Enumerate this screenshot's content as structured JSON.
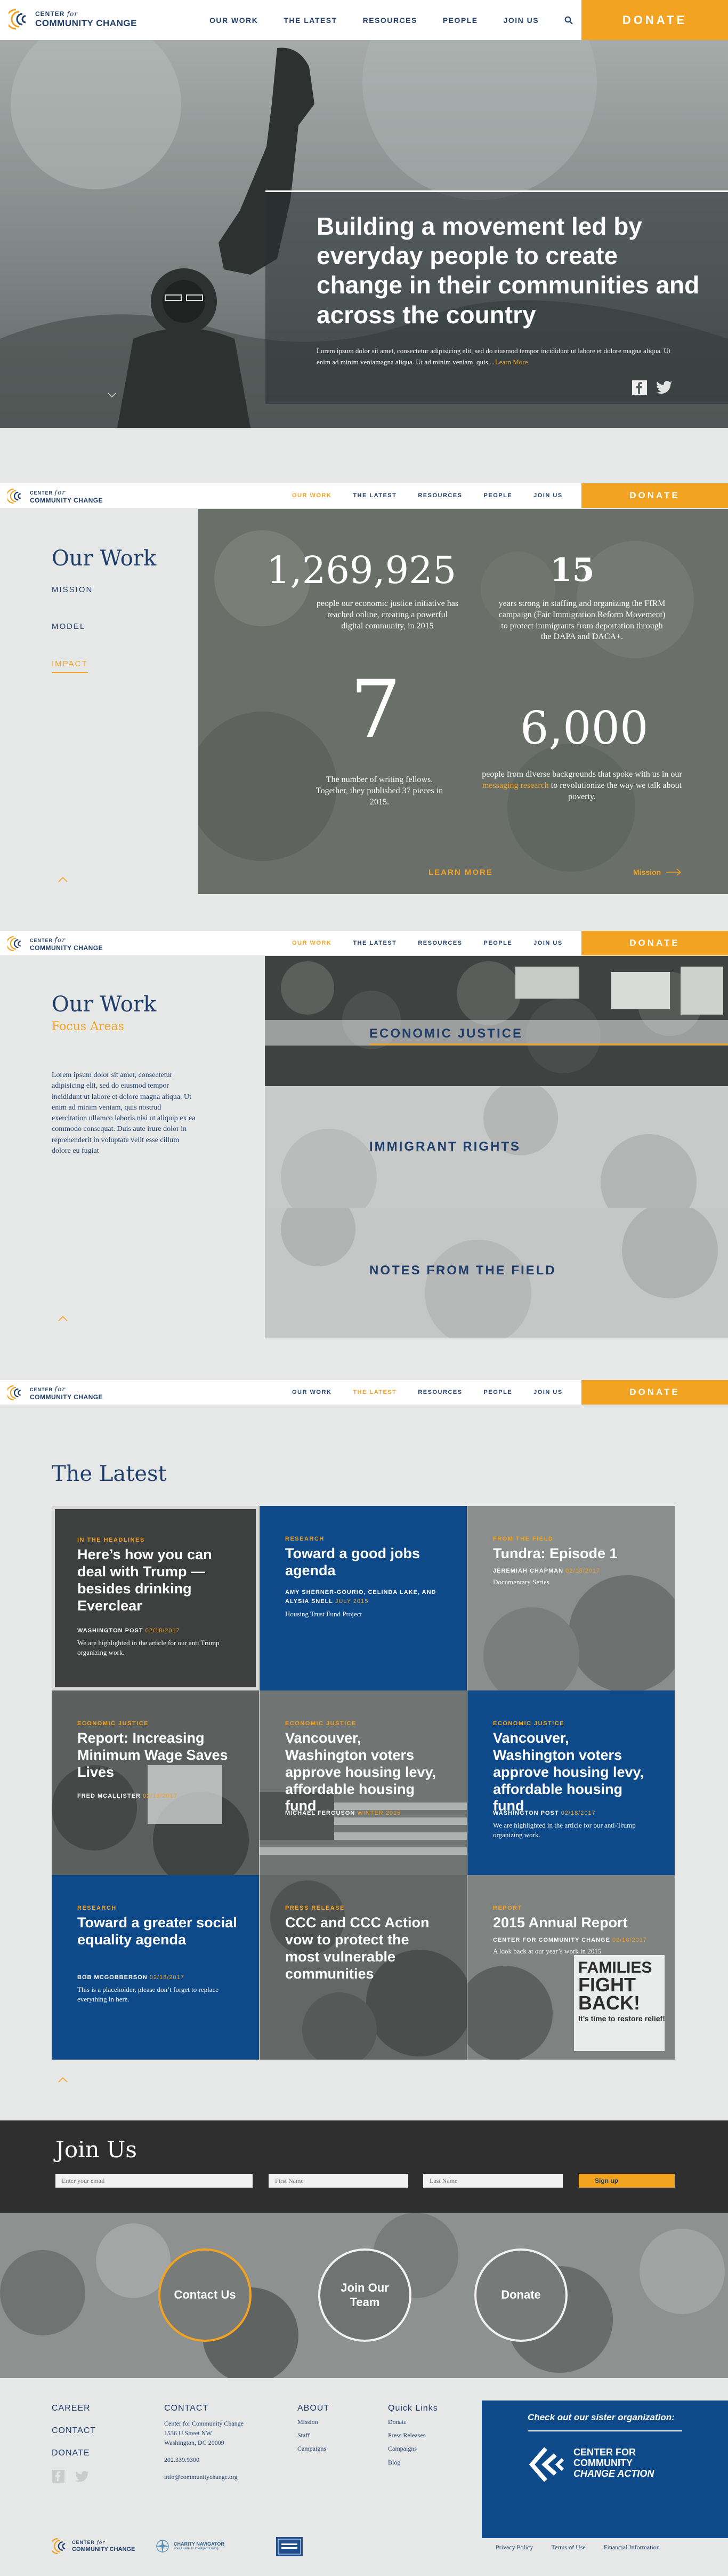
{
  "brand": {
    "line1_a": "CENTER",
    "line1_b": "for",
    "line2": "COMMUNITY CHANGE",
    "orange": "#f2a321",
    "navy": "#1f3d6b",
    "blue": "#0e4a8a"
  },
  "nav": {
    "items": [
      "OUR WORK",
      "THE LATEST",
      "RESOURCES",
      "PEOPLE",
      "JOIN US"
    ],
    "donate": "DONATE",
    "search_icon": "search-icon"
  },
  "hero": {
    "headline": "Building a movement led by everyday people to create change in their communities and across the country",
    "body": "Lorem ipsum dolor sit amet, consectetur adipisicing elit, sed do eiusmod tempor incididunt ut labore et dolore magna aliqua. Ut enim ad minim veniamagna aliqua. Ut ad minim veniam, quis...",
    "learn_more": "Learn More"
  },
  "our_work": {
    "title": "Our Work",
    "side_links": [
      "MISSION",
      "MODEL",
      "IMPACT"
    ],
    "stats": [
      {
        "num": "1,269,925",
        "text": "people our economic justice initiative has reached online, creating a powerful digital community, in 2015"
      },
      {
        "num": "15",
        "text": "years strong in staffing and organizing the FIRM campaign (Fair Immigration Reform Movement) to protect immigrants from deportation through the DAPA and DACA+."
      },
      {
        "num": "7",
        "text": "The number of writing fellows. Together, they published 37 pieces in 2015."
      },
      {
        "num": "6,000",
        "text_a": "people from diverse backgrounds that spoke with us in our ",
        "text_link": "messaging research",
        "text_b": " to revolutionize the way we talk about poverty."
      }
    ],
    "learn_more": "LEARN MORE",
    "next": "Mission"
  },
  "focus": {
    "title": "Our Work",
    "subtitle": "Focus Areas",
    "body": "Lorem ipsum dolor sit amet, consectetur adipisicing elit, sed do eiusmod tempor incididunt ut labore et dolore magna aliqua. Ut enim ad minim veniam, quis nostrud exercitation ullamco laboris nisi ut aliquip ex ea commodo consequat. Duis aute irure dolor in reprehenderit in voluptate velit esse cillum dolore eu fugiat",
    "areas": [
      "ECONOMIC JUSTICE",
      "IMMIGRANT RIGHTS",
      "NOTES FROM THE FIELD"
    ]
  },
  "latest": {
    "title": "The Latest",
    "tiles": [
      {
        "cat": "IN THE HEADLINES",
        "title": "Here’s how you can deal with Trump — besides drinking Everclear",
        "meta": "WASHINGTON POST",
        "date": "02/18/2017",
        "desc": "We are highlighted in the article for our anti Trump organizing work."
      },
      {
        "cat": "RESEARCH",
        "title": "Toward a good jobs agenda",
        "meta": "AMY SHERNER-GOURIO, CELINDA LAKE, AND ALYSIA SNELL",
        "date": "JULY 2015",
        "desc": "Housing Trust Fund Project"
      },
      {
        "cat": "FROM THE FIELD",
        "title": "Tundra: Episode 1",
        "meta": "JEREMIAH CHAPMAN",
        "date": "02/18/2017",
        "desc": "Documentary Series"
      },
      {
        "cat": "ECONOMIC JUSTICE",
        "title": "Report: Increasing Minimum Wage Saves Lives",
        "meta": "FRED MCALLISTER",
        "date": "02/18/2017",
        "desc": ""
      },
      {
        "cat": "ECONOMIC JUSTICE",
        "title": "Vancouver, Washington voters approve housing levy, affordable housing fund",
        "meta": "MICHAEL FERGUSON",
        "date": "WINTER 2015",
        "desc": ""
      },
      {
        "cat": "ECONOMIC JUSTICE",
        "title": "Vancouver, Washington voters approve housing levy, affordable housing fund",
        "meta": "WASHINGTON POST",
        "date": "02/18/2017",
        "desc": "We are highlighted in the article for our anti-Trump organizing work."
      },
      {
        "cat": "RESEARCH",
        "title": "Toward a greater social equality agenda",
        "meta": "BOB MCGOBBERSON",
        "date": "02/18/2017",
        "desc": "This is a placeholder, please don’t forget to replace everything in here."
      },
      {
        "cat": "PRESS RELEASE",
        "title": "CCC and CCC Action vow to protect the most vulnerable communities",
        "meta": "",
        "date": "",
        "desc": ""
      },
      {
        "cat": "REPORT",
        "title": "2015 Annual Report",
        "meta": "CENTER FOR COMMUNITY CHANGE",
        "date": "02/18/2017",
        "desc": "A look back at our year’s work in 2015"
      }
    ],
    "sign_text": [
      "FAMILIES",
      "FIGHT",
      "BACK!",
      "It’s time to restore relief!"
    ]
  },
  "join": {
    "title": "Join Us",
    "email_placeholder": "Enter your email",
    "first_placeholder": "First Name",
    "last_placeholder": "Last Name",
    "signup": "Sign up",
    "circles": [
      "Contact Us",
      "Join Our Team",
      "Donate"
    ]
  },
  "footer": {
    "left_links": [
      "CAREER",
      "CONTACT",
      "DONATE"
    ],
    "contact_h": "CONTACT",
    "contact_lines": [
      "Center for Community Change",
      "1536 U Street NW",
      "Washington, DC 20009",
      "",
      "202.339.9300",
      "",
      "info@communitychange.org"
    ],
    "about_h": "ABOUT",
    "about_links": [
      "Mission",
      "Staff",
      "Campaigns"
    ],
    "quick_h": "Quick Links",
    "quick_links": [
      "Donate",
      "Press Releases",
      "Campaigns",
      "Blog"
    ],
    "sister_h": "Check out our sister organization:",
    "sister_l1": "CENTER FOR",
    "sister_l2": "COMMUNITY",
    "sister_l3": "CHANGE ACTION",
    "bottom_links": [
      "Privacy Policy",
      "Terms of Use",
      "Financial Information"
    ],
    "charity_l1": "CHARITY NAVIGATOR",
    "charity_l2": "Your Guide To Intelligent Giving"
  }
}
